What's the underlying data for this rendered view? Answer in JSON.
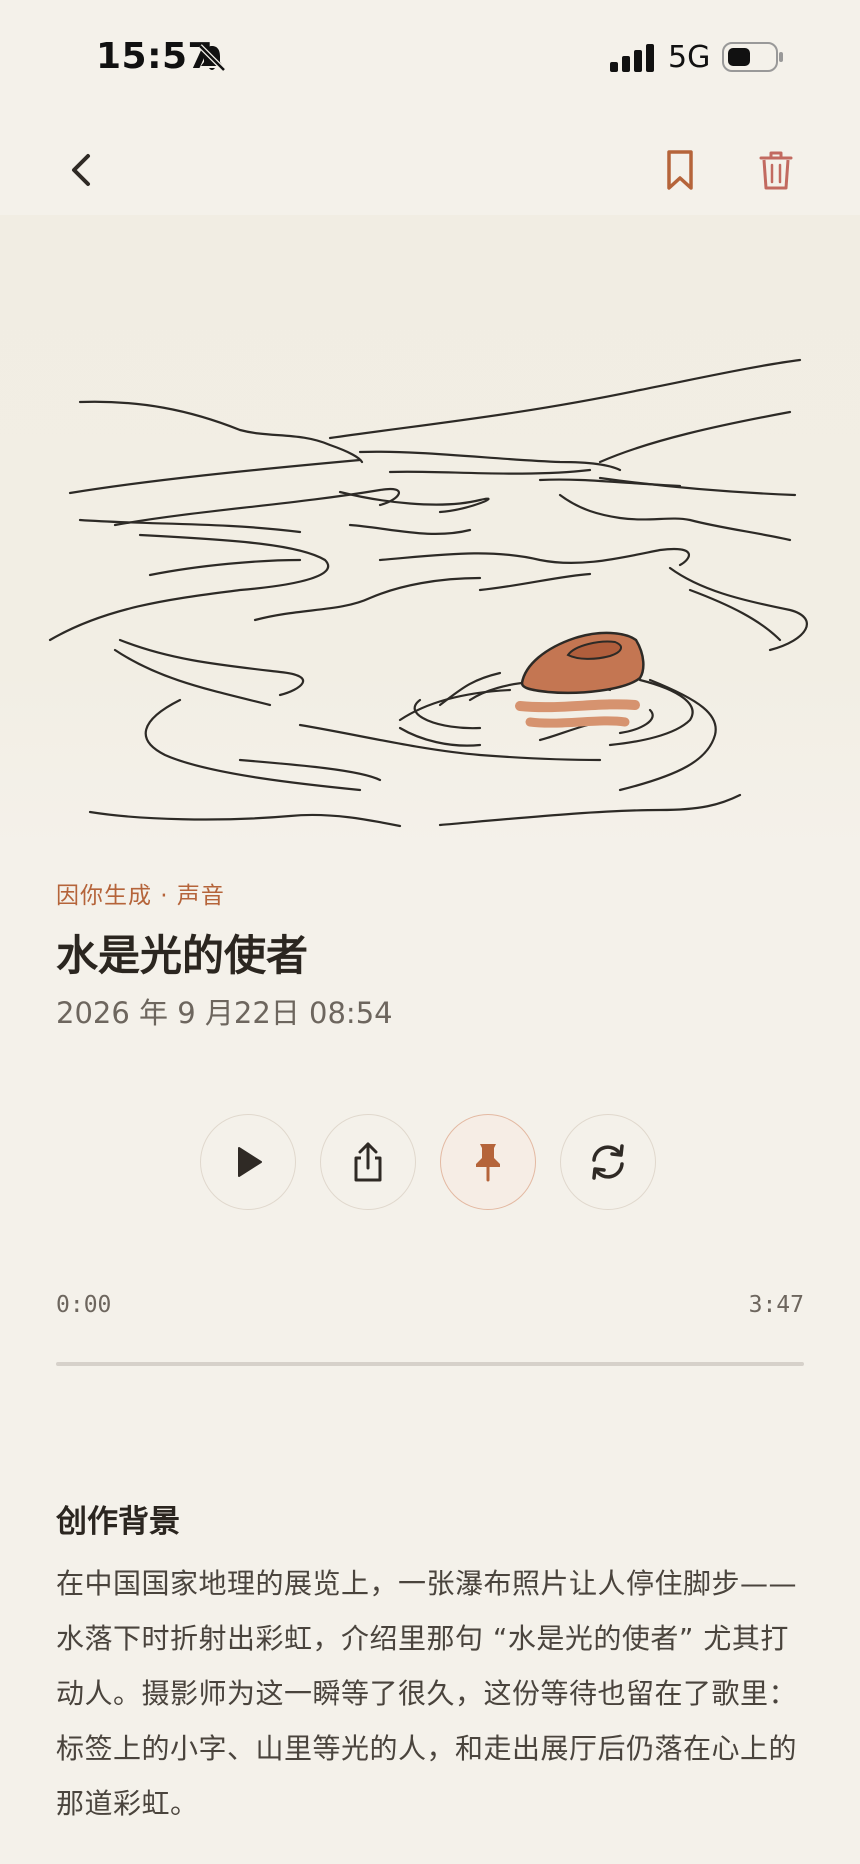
{
  "status_bar": {
    "time": "15:57",
    "network": "5G",
    "icons": [
      "bell-muted-icon",
      "signal-icon",
      "battery-icon"
    ]
  },
  "nav": {
    "icons": [
      "back-chevron-icon",
      "bookmark-icon",
      "trash-icon"
    ],
    "accent_color": "#b5643a"
  },
  "song": {
    "tagline": "因你生成 · 声音",
    "title": "水是光的使者",
    "date": "2026 年 9 月22日 08:54"
  },
  "controls": {
    "buttons": [
      "play-icon",
      "share-icon",
      "pin-icon",
      "regenerate-icon"
    ]
  },
  "player": {
    "current_time": "0:00",
    "duration": "3:47",
    "progress_fraction": 0
  },
  "background": {
    "heading": "创作背景",
    "body": "在中国国家地理的展览上，一张瀑布照片让人停住脚步——水落下时折射出彩虹，介绍里那句 “水是光的使者” 尤其打动人。摄影师为这一瞬等了很久，这份等待也留在了歌里：标签上的小字、山里等光的人，和走出展厅后仍落在心上的那道彩虹。"
  },
  "colors": {
    "background": "#f4f1ea",
    "accent": "#b5643a",
    "text": "#2b2620",
    "muted": "#6d665e"
  }
}
